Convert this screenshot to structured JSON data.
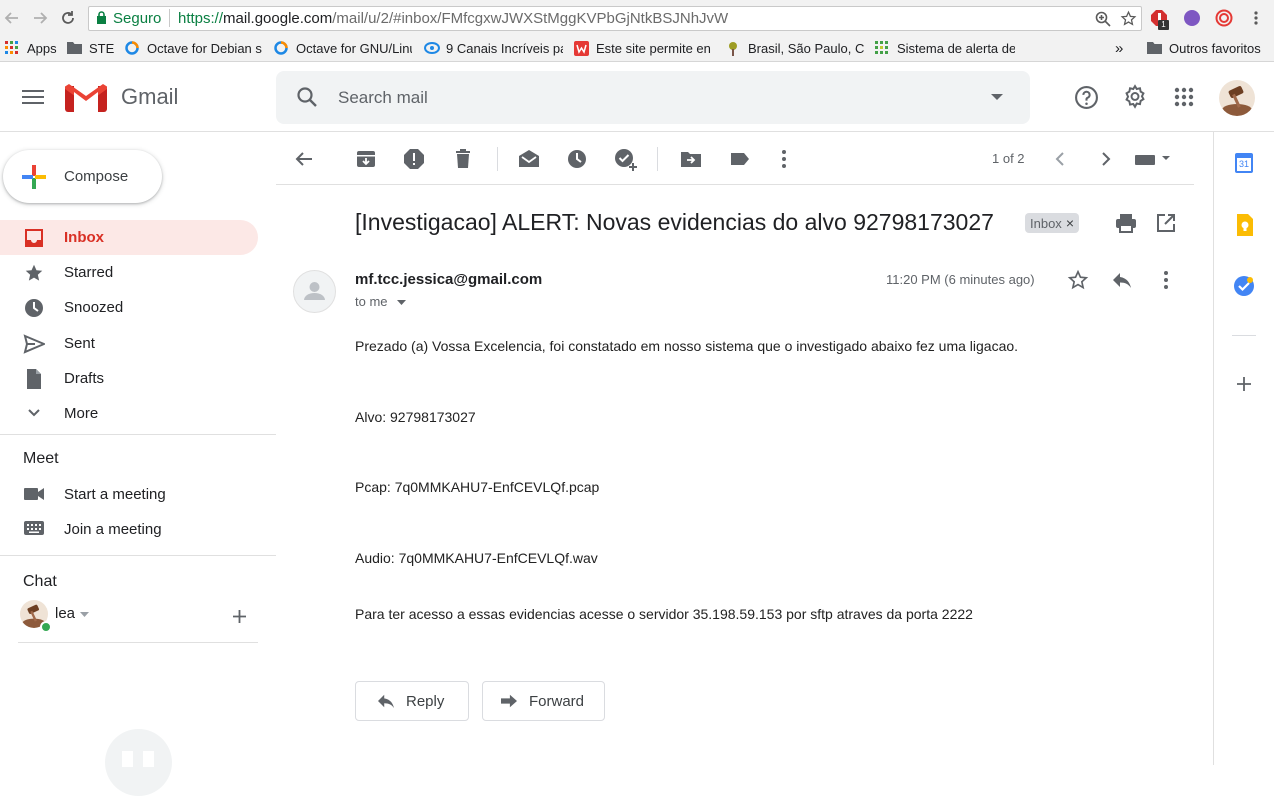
{
  "browser": {
    "secure_label": "Seguro",
    "url_scheme": "https://",
    "url_host": "mail.google.com",
    "url_path": "/mail/u/2/#inbox/FMfcgxwJWXStMggKVPbGjNtkBSJNhJvW",
    "bookmarks": [
      {
        "label": "Apps",
        "icon": "apps-grid-icon"
      },
      {
        "label": "STE",
        "icon": "folder-icon"
      },
      {
        "label": "Octave for Debian s",
        "icon": "octave-icon"
      },
      {
        "label": "Octave for GNU/Linu",
        "icon": "octave-icon"
      },
      {
        "label": "9 Canais Incríveis pa",
        "icon": "site-icon"
      },
      {
        "label": "Este site permite en",
        "icon": "site-icon"
      },
      {
        "label": "Brasil, São Paulo, Ca",
        "icon": "site-icon"
      },
      {
        "label": "Sistema de alerta de",
        "icon": "site-icon"
      }
    ],
    "overflow_label": "»",
    "other_bookmarks": "Outros favoritos",
    "extension_badge": "1"
  },
  "gmail": {
    "logo_text": "Gmail",
    "search_placeholder": "Search mail",
    "compose_label": "Compose",
    "nav": [
      {
        "label": "Inbox",
        "icon": "inbox-icon",
        "active": true
      },
      {
        "label": "Starred",
        "icon": "star-icon"
      },
      {
        "label": "Snoozed",
        "icon": "clock-icon"
      },
      {
        "label": "Sent",
        "icon": "send-icon"
      },
      {
        "label": "Drafts",
        "icon": "draft-icon"
      },
      {
        "label": "More",
        "icon": "chevron-down-icon"
      }
    ],
    "meet": {
      "title": "Meet",
      "items": [
        {
          "label": "Start a meeting",
          "icon": "video-icon"
        },
        {
          "label": "Join a meeting",
          "icon": "keyboard-icon"
        }
      ]
    },
    "chat": {
      "title": "Chat",
      "user": "lea"
    },
    "toolbar": {
      "page_count": "1 of 2"
    },
    "side_panel": {
      "calendar_day": "31"
    }
  },
  "message": {
    "subject": "[Investigacao] ALERT: Novas evidencias do alvo 92798173027",
    "label_chip": "Inbox",
    "chip_close": "×",
    "sender": "mf.tcc.jessica@gmail.com",
    "to": "to me",
    "time": "11:20 PM (6 minutes ago)",
    "body": [
      "Prezado (a) Vossa Excelencia, foi constatado em nosso sistema que o investigado abaixo fez uma ligacao.",
      "Alvo: 92798173027",
      "Pcap: 7q0MMKAHU7-EnfCEVLQf.pcap",
      "Audio: 7q0MMKAHU7-EnfCEVLQf.wav",
      "Para ter acesso a essas evidencias acesse o servidor 35.198.59.153 por sftp atraves da porta 2222"
    ],
    "reply_label": "Reply",
    "forward_label": "Forward"
  },
  "colors": {
    "accent_red": "#d93025",
    "active_nav_bg": "#fce8e6",
    "secure_green": "#0b8043"
  }
}
